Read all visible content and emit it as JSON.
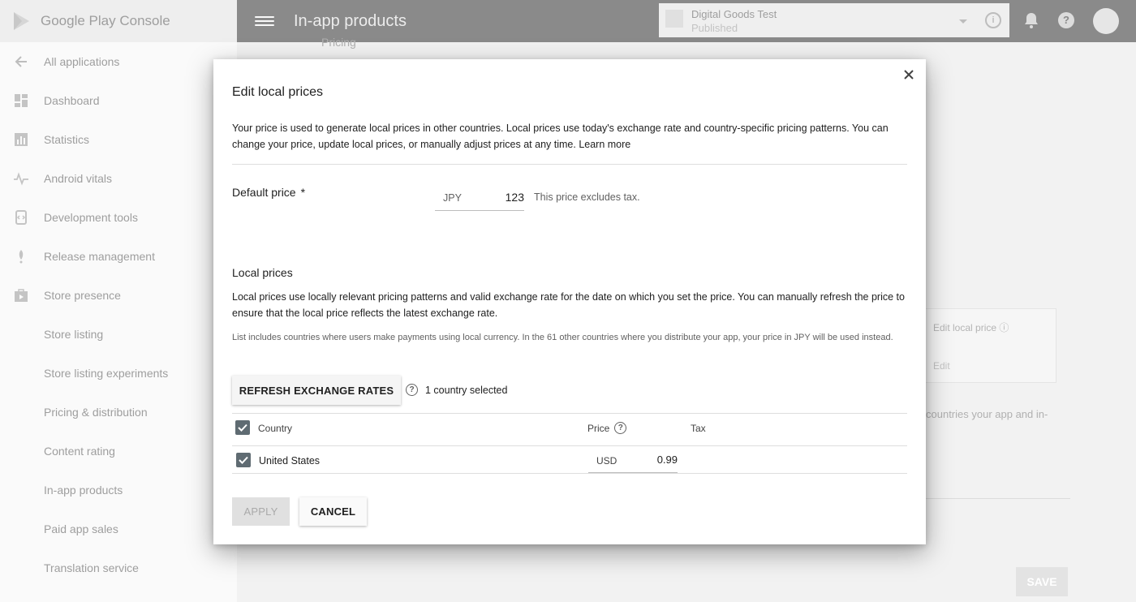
{
  "brand": {
    "name": "Google Play Console"
  },
  "sidebar": {
    "items": [
      {
        "label": "All applications",
        "icon": "arrow-left-icon"
      },
      {
        "label": "Dashboard",
        "icon": "dashboard-icon"
      },
      {
        "label": "Statistics",
        "icon": "bar-chart-icon"
      },
      {
        "label": "Android vitals",
        "icon": "pulse-icon"
      },
      {
        "label": "Development tools",
        "icon": "wrench-icon"
      },
      {
        "label": "Release management",
        "icon": "rocket-icon"
      },
      {
        "label": "Store presence",
        "icon": "shopping-bag-icon"
      }
    ],
    "sub_items": [
      {
        "label": "Store listing"
      },
      {
        "label": "Store listing experiments"
      },
      {
        "label": "Pricing & distribution"
      },
      {
        "label": "Content rating"
      },
      {
        "label": "In-app products"
      },
      {
        "label": "Paid app sales"
      },
      {
        "label": "Translation service"
      }
    ]
  },
  "header": {
    "page_title": "In-app products",
    "app_name": "Digital Goods Test",
    "app_status": "Published",
    "info_icon": "info-icon",
    "notification_icon": "bell-icon",
    "help_icon": "help-icon",
    "avatar_icon": "avatar-icon"
  },
  "background": {
    "section_label": "Pricing",
    "edit_local_price": "Edit local price",
    "edit_link": "Edit",
    "countries_text": "countries your app and in-",
    "save_label": "SAVE"
  },
  "dialog": {
    "title": "Edit local prices",
    "intro": "Your price is used to generate local prices in other countries. Local prices use today's exchange rate and country-specific pricing patterns. You can change your price, update local prices, or manually adjust prices at any time.",
    "learn_more": "Learn more",
    "default_price_label": "Default price",
    "required_mark": "*",
    "default_currency": "JPY",
    "default_amount": "123",
    "price_note": "This price excludes tax.",
    "local_prices_title": "Local prices",
    "local_prices_desc": "Local prices use locally relevant pricing patterns and valid exchange rate for the date on which you set the price. You can manually refresh the price to ensure that the local price reflects the latest exchange rate.",
    "local_prices_note": "List includes countries where users make payments using local currency. In the 61 other countries where you distribute your app, your price in JPY will be used instead.",
    "refresh_label": "REFRESH EXCHANGE RATES",
    "selected_count": "1 country selected",
    "table": {
      "headers": {
        "country": "Country",
        "price": "Price",
        "tax": "Tax"
      },
      "rows": [
        {
          "country": "United States",
          "currency": "USD",
          "price": "0.99",
          "tax": "",
          "checked": true
        }
      ]
    },
    "apply_label": "APPLY",
    "cancel_label": "CANCEL",
    "close_icon": "close-icon"
  },
  "colors": {
    "topbar": "#8a8a8a",
    "checkbox": "#5f6b72",
    "overlay_background": "#f2f2f2"
  }
}
